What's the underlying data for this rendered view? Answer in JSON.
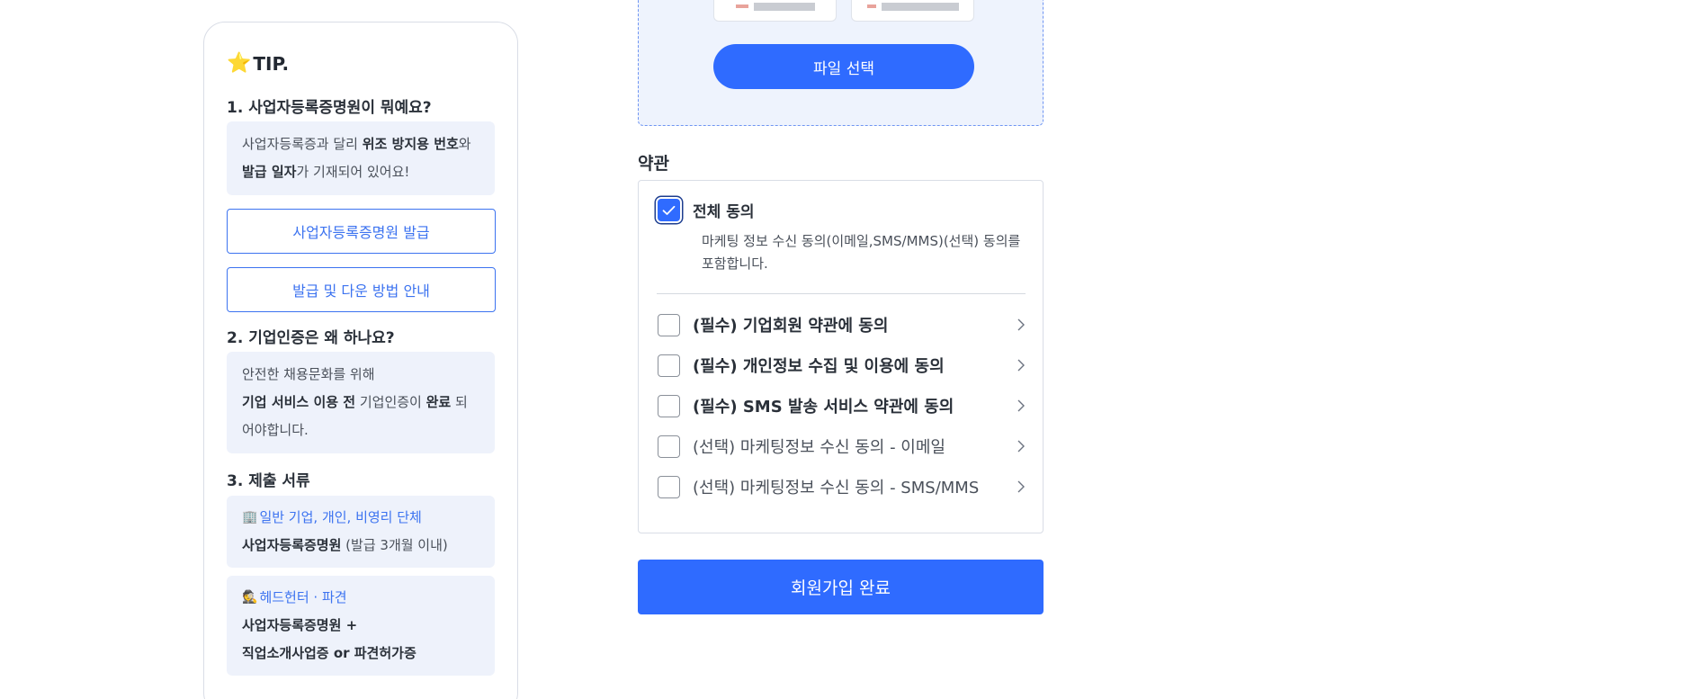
{
  "tip": {
    "star_icon": "star-emoji-icon",
    "title": "TIP.",
    "q1": "1. 사업자등록증명원이 뭐예요?",
    "q1_text_a": "사업자등록증과 달리 ",
    "q1_bold_a": "위조 방지용 번호",
    "q1_text_b": "와",
    "q1_bold_b": "발급 일자",
    "q1_text_c": "가 기재되어 있어요!",
    "issue_button": "사업자등록증명원 발급",
    "guide_button": "발급 및 다운 방법 안내",
    "q2": "2. 기업인증은 왜 하나요?",
    "q2_line1": "안전한 채용문화를 위해",
    "q2_bold_a": "기업 서비스 이용 전",
    "q2_text_b": " 기업인증이 ",
    "q2_bold_b": "완료",
    "q2_text_c": " 되어야합니다.",
    "q3": "3. 제출 서류",
    "doc1_icon": "building-emoji-icon",
    "doc1_head": "일반 기업, 개인, 비영리 단체",
    "doc1_bold": "사업자등록증명원",
    "doc1_text": " (발급 3개월 이내)",
    "doc2_icon": "detective-emoji-icon",
    "doc2_head": "헤드헌터 · 파견",
    "doc2_line1": "사업자등록증명원 +",
    "doc2_line2": "직업소개사업증 or 파견허가증"
  },
  "upload": {
    "select_button": "파일 선택"
  },
  "terms": {
    "heading": "약관",
    "all_label": "전체 동의",
    "all_checked": true,
    "all_desc": "마케팅 정보 수신 동의(이메일,SMS/MMS)(선택) 동의를 포함합니다.",
    "items": [
      {
        "label": "(필수) 기업회원 약관에 동의",
        "required": true,
        "checked": false
      },
      {
        "label": "(필수) 개인정보 수집 및 이용에 동의",
        "required": true,
        "checked": false
      },
      {
        "label": "(필수) SMS 발송 서비스 약관에 동의",
        "required": true,
        "checked": false
      },
      {
        "label": "(선택) 마케팅정보 수신 동의 - 이메일",
        "required": false,
        "checked": false
      },
      {
        "label": "(선택) 마케팅정보 수신 동의 - SMS/MMS",
        "required": false,
        "checked": false
      }
    ]
  },
  "submit": {
    "label": "회원가입 완료"
  },
  "colors": {
    "accent": "#2f6bff",
    "link": "#3c73f0",
    "tip_bg": "#eef2fb"
  }
}
